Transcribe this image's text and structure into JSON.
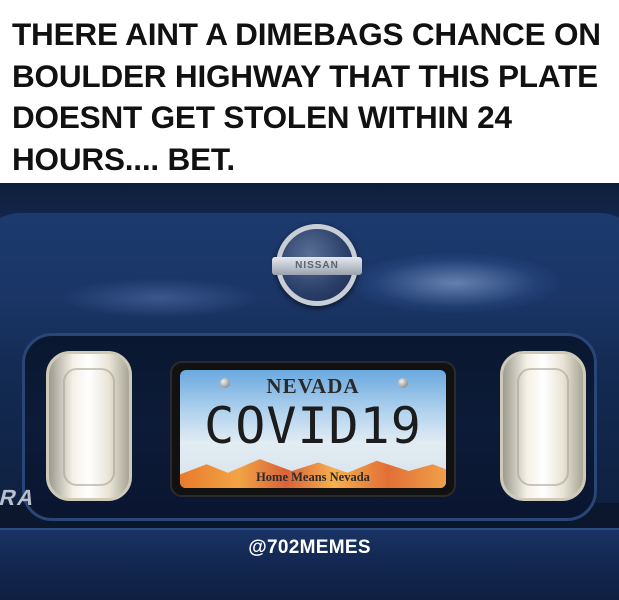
{
  "caption": {
    "text": "THERE AINT A DIMEBAGS CHANCE ON BOULDER HIGHWAY THAT THIS PLATE DOESNT GET STOLEN WITHIN 24 HOURS.... BET."
  },
  "photo": {
    "emblem_text": "NISSAN",
    "plate": {
      "state": "NEVADA",
      "number": "COVID19",
      "slogan": "Home Means Nevada"
    },
    "badge_text": "RA",
    "watermark": "@702MEMES",
    "colors": {
      "car_paint": "#17305e",
      "plate_sky": "#6aa8df",
      "plate_mountains": "#e87a2c"
    }
  }
}
